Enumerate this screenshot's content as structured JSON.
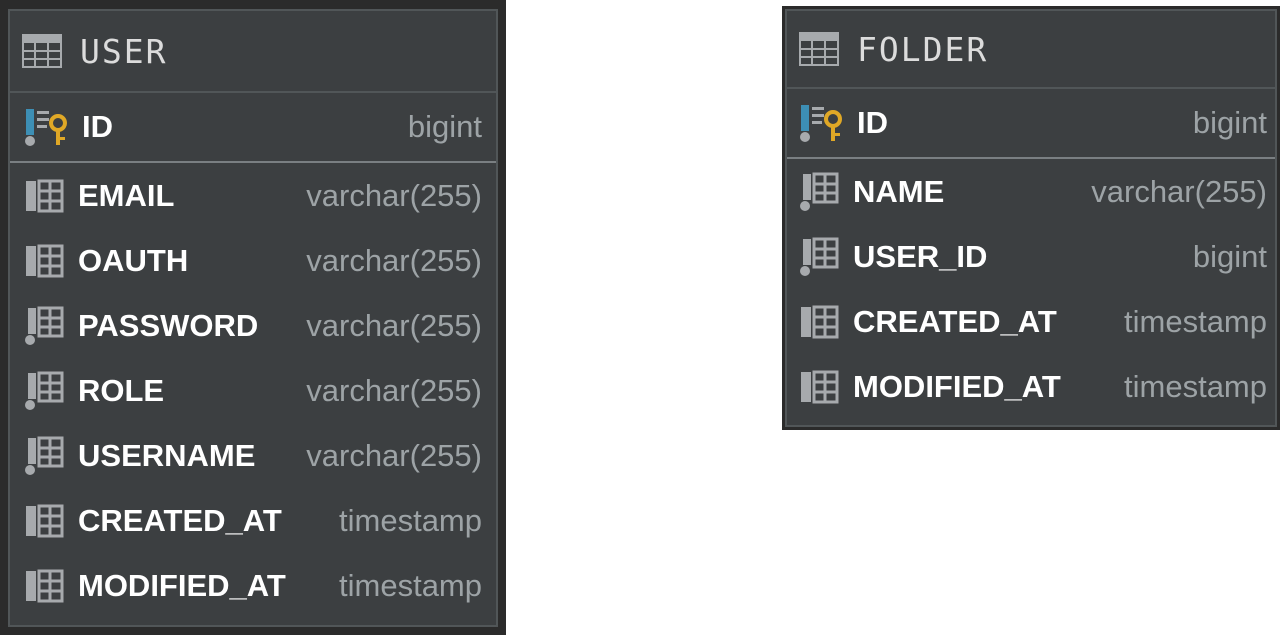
{
  "tables": [
    {
      "id": "user",
      "title": "USER",
      "primary_key": {
        "name": "ID",
        "type": "bigint",
        "icon": "primary-key-icon"
      },
      "columns": [
        {
          "name": "EMAIL",
          "type": "varchar(255)",
          "icon": "column-icon"
        },
        {
          "name": "OAUTH",
          "type": "varchar(255)",
          "icon": "column-icon"
        },
        {
          "name": "PASSWORD",
          "type": "varchar(255)",
          "icon": "not-null-column-icon"
        },
        {
          "name": "ROLE",
          "type": "varchar(255)",
          "icon": "not-null-column-icon"
        },
        {
          "name": "USERNAME",
          "type": "varchar(255)",
          "icon": "not-null-column-icon"
        },
        {
          "name": "CREATED_AT",
          "type": "timestamp",
          "icon": "column-icon"
        },
        {
          "name": "MODIFIED_AT",
          "type": "timestamp",
          "icon": "column-icon"
        }
      ]
    },
    {
      "id": "folder",
      "title": "FOLDER",
      "primary_key": {
        "name": "ID",
        "type": "bigint",
        "icon": "primary-key-icon"
      },
      "columns": [
        {
          "name": "NAME",
          "type": "varchar(255)",
          "icon": "not-null-column-icon"
        },
        {
          "name": "USER_ID",
          "type": "bigint",
          "icon": "not-null-column-icon"
        },
        {
          "name": "CREATED_AT",
          "type": "timestamp",
          "icon": "column-icon"
        },
        {
          "name": "MODIFIED_AT",
          "type": "timestamp",
          "icon": "column-icon"
        }
      ]
    }
  ],
  "colors": {
    "card_background": "#3c3f41",
    "card_border": "#2b2b2b",
    "column_name": "#ffffff",
    "column_type": "#9da3a6",
    "key_icon": "#e0a826",
    "key_bar": "#3d8fb5"
  }
}
